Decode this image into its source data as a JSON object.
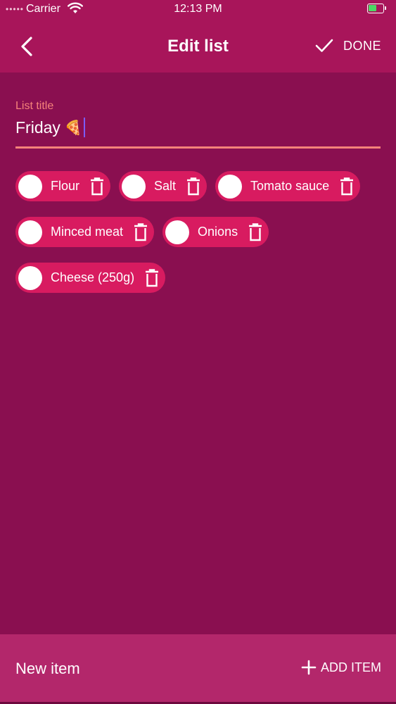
{
  "status_bar": {
    "carrier": "Carrier",
    "time": "12:13 PM",
    "signal_glyph": "•••••",
    "battery_color": "#4cd964"
  },
  "header": {
    "title": "Edit list",
    "done_label": "DONE",
    "background": "#a8155a"
  },
  "form": {
    "title_label": "List title",
    "title_value": "Friday",
    "title_emoji": "🍕",
    "accent": "#f5837a"
  },
  "items": [
    {
      "name": "Flour"
    },
    {
      "name": "Salt"
    },
    {
      "name": "Tomato sauce"
    },
    {
      "name": "Minced meat"
    },
    {
      "name": "Onions"
    },
    {
      "name": "Cheese (250g)"
    }
  ],
  "footer": {
    "new_item_placeholder": "New item",
    "add_label": "ADD ITEM"
  },
  "colors": {
    "page_background": "#8a0f50",
    "chip": "#d81b60",
    "footer": "#b3276b"
  }
}
